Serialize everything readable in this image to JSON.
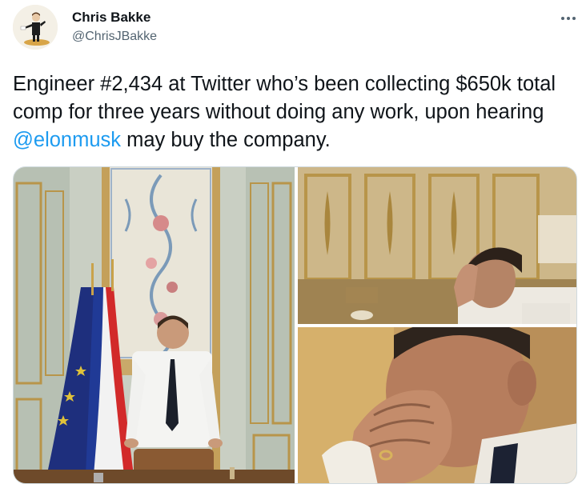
{
  "author": {
    "display_name": "Chris Bakke",
    "handle": "@ChrisJBakke"
  },
  "tweet": {
    "text_before": "Engineer #2,434 at Twitter who’s been collecting $650k total comp for three years without doing any work, upon hearing ",
    "mention": "@elonmusk",
    "text_after": " may buy the company."
  },
  "icons": {
    "more": "more-horizontal-icon"
  },
  "colors": {
    "text": "#0f1419",
    "secondary": "#536471",
    "link": "#1d9bf0",
    "border": "#cfd9de"
  },
  "media": {
    "count": 3
  }
}
